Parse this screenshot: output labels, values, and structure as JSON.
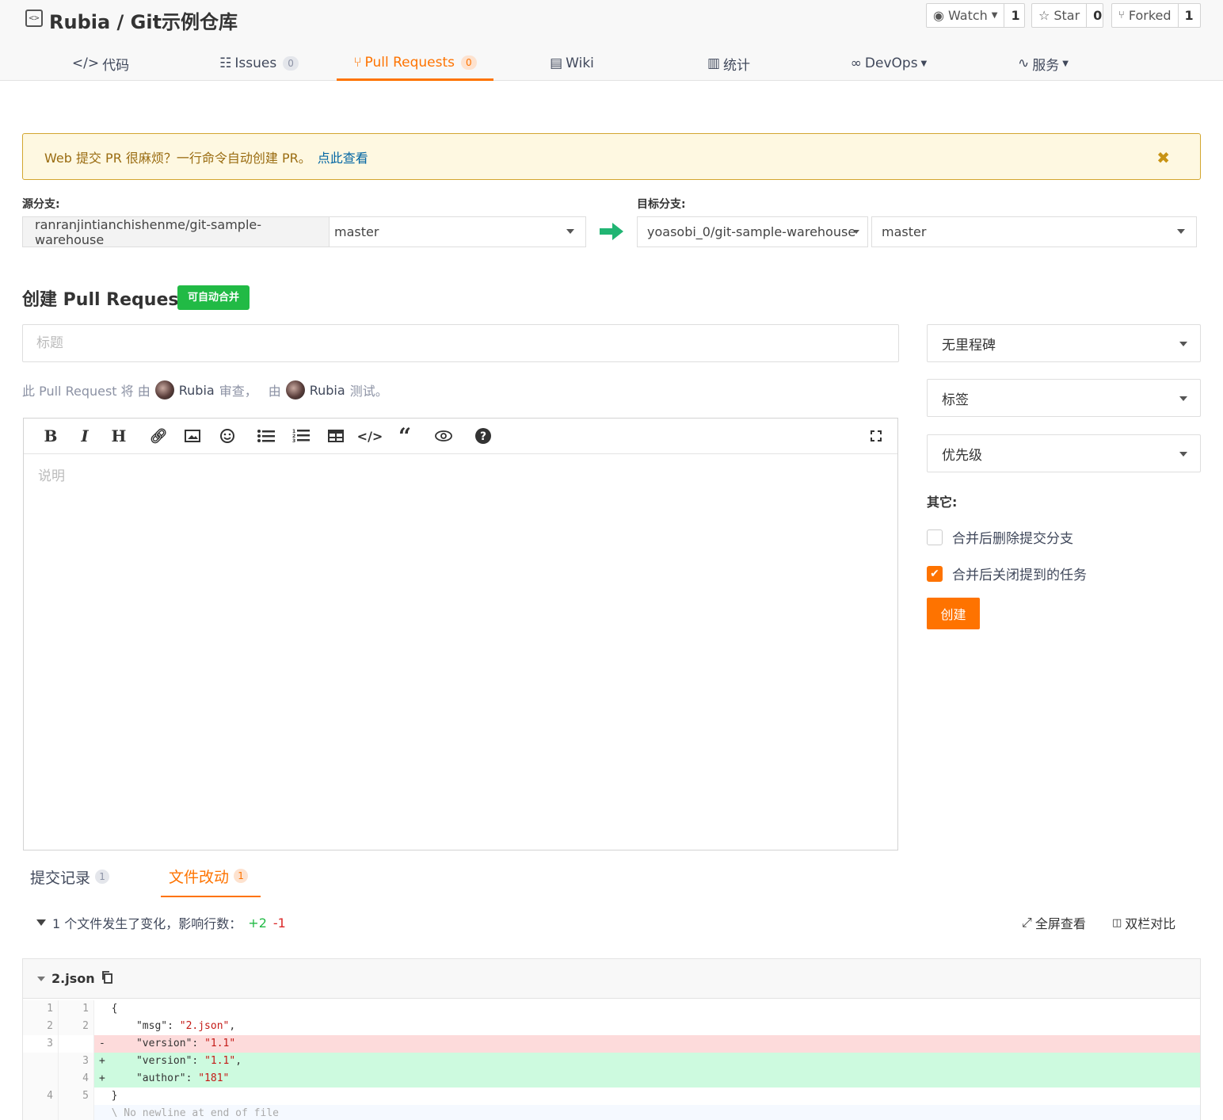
{
  "repo": {
    "title": "Rubia / Git示例仓库",
    "icon": "code-repo-icon"
  },
  "header_buttons": {
    "watch": {
      "label": "Watch",
      "count": "1"
    },
    "star": {
      "label": "Star",
      "count": "0"
    },
    "forked": {
      "label": "Forked",
      "count": "1"
    }
  },
  "nav": {
    "code": "代码",
    "issues": {
      "label": "Issues",
      "count": "0"
    },
    "pulls": {
      "label": "Pull Requests",
      "count": "0"
    },
    "wiki": "Wiki",
    "stats": "统计",
    "devops": "DevOps",
    "services": "服务"
  },
  "notice": {
    "text": "Web 提交 PR 很麻烦？一行命令自动创建 PR。",
    "link": "点此查看",
    "close": "✖"
  },
  "source": {
    "label": "源分支:",
    "repo": "ranranjintianchishenme/git-sample-warehouse",
    "branch": "master"
  },
  "target": {
    "label": "目标分支:",
    "repo": "yoasobi_0/git-sample-warehouse",
    "branch": "master"
  },
  "form": {
    "heading": "创建 Pull Request",
    "merge_badge": "可自动合并",
    "title_placeholder": "标题",
    "review_prefix": "此 Pull Request 将 由",
    "reviewer": "Rubia",
    "review_mid": "审查，",
    "test_prefix": "由",
    "tester": "Rubia",
    "test_suffix": "测试。",
    "desc_placeholder": "说明"
  },
  "toolbar": [
    "B",
    "I",
    "H"
  ],
  "sidebar": {
    "milestone": "无里程碑",
    "labels": "标签",
    "priority": "优先级",
    "other_label": "其它:",
    "opt_delete_branch": "合并后删除提交分支",
    "opt_close_issues": "合并后关闭提到的任务",
    "create_button": "创建"
  },
  "bottom_tabs": {
    "commits": {
      "label": "提交记录",
      "count": "1"
    },
    "files": {
      "label": "文件改动",
      "count": "1"
    }
  },
  "diff_summary": {
    "text": "1 个文件发生了变化，影响行数：",
    "added": "+2",
    "removed": "-1",
    "fullscreen": "全屏查看",
    "split": "双栏对比"
  },
  "file": {
    "name": "2.json",
    "lines": [
      {
        "type": "ctx",
        "old": "1",
        "new": "1",
        "sign": " ",
        "text": "{"
      },
      {
        "type": "ctx",
        "old": "2",
        "new": "2",
        "sign": " ",
        "text": "    \"msg\": \"2.json\","
      },
      {
        "type": "del",
        "old": "3",
        "new": "",
        "sign": "-",
        "text": "    \"version\": \"1.1\""
      },
      {
        "type": "add",
        "old": "",
        "new": "3",
        "sign": "+",
        "text": "    \"version\": \"1.1\","
      },
      {
        "type": "add",
        "old": "",
        "new": "4",
        "sign": "+",
        "text": "    \"author\": \"181\""
      },
      {
        "type": "ctx",
        "old": "4",
        "new": "5",
        "sign": " ",
        "text": "}"
      },
      {
        "type": "note",
        "old": "",
        "new": "",
        "sign": " ",
        "text": "\\ No newline at end of file"
      }
    ]
  }
}
